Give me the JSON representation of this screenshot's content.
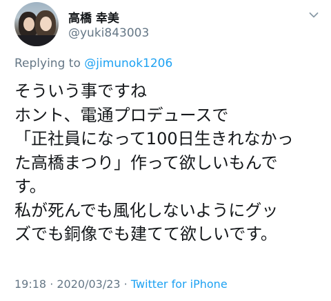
{
  "user": {
    "display_name": "高橋 幸美",
    "handle": "@yuki843003"
  },
  "reply": {
    "prefix": "Replying to ",
    "mention": "@jimunok1206"
  },
  "tweet": {
    "lines": [
      "そういう事ですね",
      "ホント、電通プロデュースで",
      "「正社員になって100日生きれなかっ",
      "た高橋まつり」作って欲しいもんで",
      "す。",
      "私が死んでも風化しないようにグッ",
      "ズでも銅像でも建てて欲しいです。"
    ]
  },
  "meta": {
    "time": "19:18",
    "separator1": " · ",
    "date": "2020/03/23",
    "separator2": " · ",
    "source": "Twitter for iPhone"
  },
  "icons": {
    "menu": "chevron-down-icon"
  },
  "colors": {
    "text": "#14171a",
    "secondary": "#657786",
    "link": "#1da1f2"
  }
}
